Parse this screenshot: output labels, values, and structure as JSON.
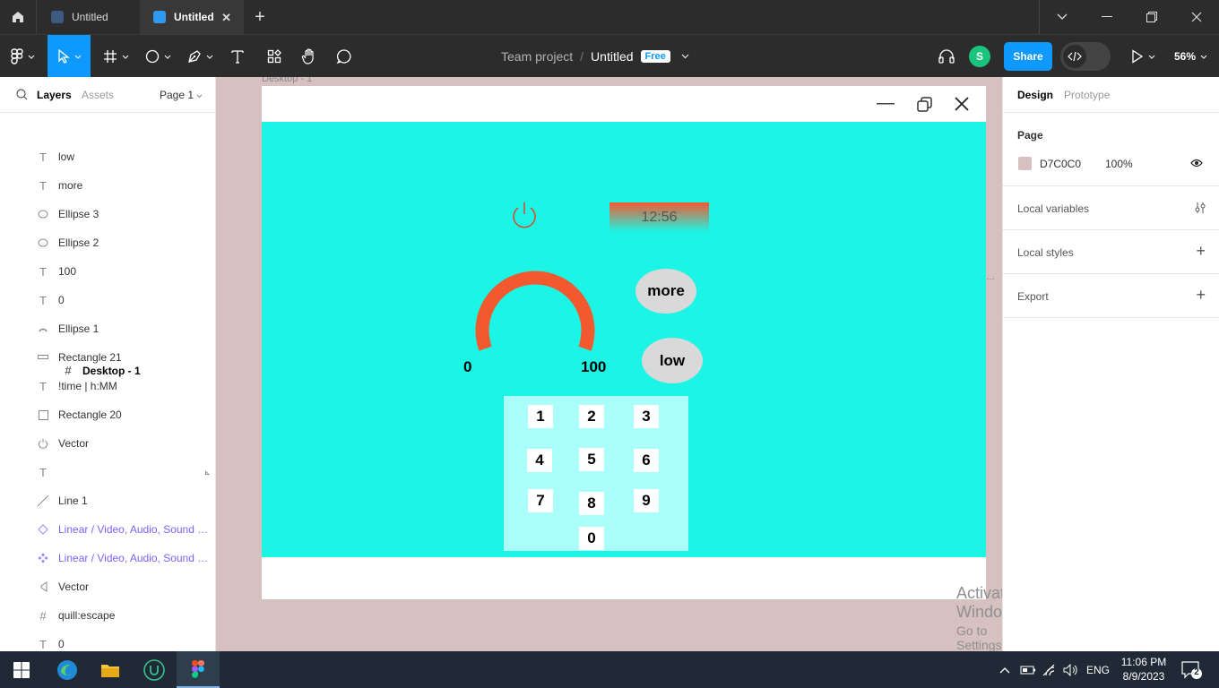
{
  "tabs": [
    {
      "label": "Untitled"
    },
    {
      "label": "Untitled"
    }
  ],
  "toolbar": {
    "team": "Team project",
    "separator": "/",
    "file_name": "Untitled",
    "plan_badge": "Free",
    "avatar_initial": "S",
    "share_label": "Share",
    "zoom": "56%"
  },
  "left_panel": {
    "tab_layers": "Layers",
    "tab_assets": "Assets",
    "page": "Page 1",
    "layers": [
      {
        "name": "Desktop - 1",
        "icon": "frame-icon"
      },
      {
        "name": "low",
        "icon": "text-icon"
      },
      {
        "name": "more",
        "icon": "text-icon"
      },
      {
        "name": "Ellipse 3",
        "icon": "ellipse-icon"
      },
      {
        "name": "Ellipse 2",
        "icon": "ellipse-icon"
      },
      {
        "name": "100",
        "icon": "text-icon"
      },
      {
        "name": "0",
        "icon": "text-icon"
      },
      {
        "name": "Ellipse 1",
        "icon": "arc-icon"
      },
      {
        "name": "Rectangle 21",
        "icon": "rectangle-icon"
      },
      {
        "name": "!time | h:MM",
        "icon": "text-icon"
      },
      {
        "name": "Rectangle 20",
        "icon": "rectangle-icon"
      },
      {
        "name": "Vector",
        "icon": "power-icon"
      },
      {
        "name": "",
        "icon": "text-icon"
      },
      {
        "name": "Line 1",
        "icon": "line-icon"
      },
      {
        "name": "Linear / Video, Audio, Sound /...",
        "icon": "component-instance-icon"
      },
      {
        "name": "Linear / Video, Audio, Sound /...",
        "icon": "component-icon"
      },
      {
        "name": "Vector",
        "icon": "volume-icon"
      },
      {
        "name": "quill:escape",
        "icon": "frame-icon"
      },
      {
        "name": "0",
        "icon": "text-icon"
      }
    ]
  },
  "canvas": {
    "frame_label": "Desktop - 1",
    "time": "12:56",
    "more_label": "more",
    "low_label": "low",
    "gauge_min": "0",
    "gauge_max": "100",
    "gauge_fraction": 1.0,
    "keys": [
      "1",
      "2",
      "3",
      "4",
      "5",
      "6",
      "7",
      "8",
      "9",
      "0"
    ],
    "colors": {
      "canvas_bg": "#D7C0C0",
      "app_bg": "#1CF5E6",
      "accent": "#F3592F",
      "keypad_bg": "#ABFFFA",
      "pill_bg": "#D9D9D9"
    }
  },
  "watermark": {
    "line1": "Activate Windows",
    "line2": "Go to Settings to activate Windows."
  },
  "help_label": "?",
  "right_panel": {
    "tab_design": "Design",
    "tab_prototype": "Prototype",
    "page_title": "Page",
    "page_color": "D7C0C0",
    "page_opacity": "100%",
    "local_variables": "Local variables",
    "local_styles": "Local styles",
    "export": "Export"
  },
  "taskbar": {
    "language": "ENG",
    "time": "11:06 PM",
    "date": "8/9/2023",
    "notification_count": "2"
  }
}
